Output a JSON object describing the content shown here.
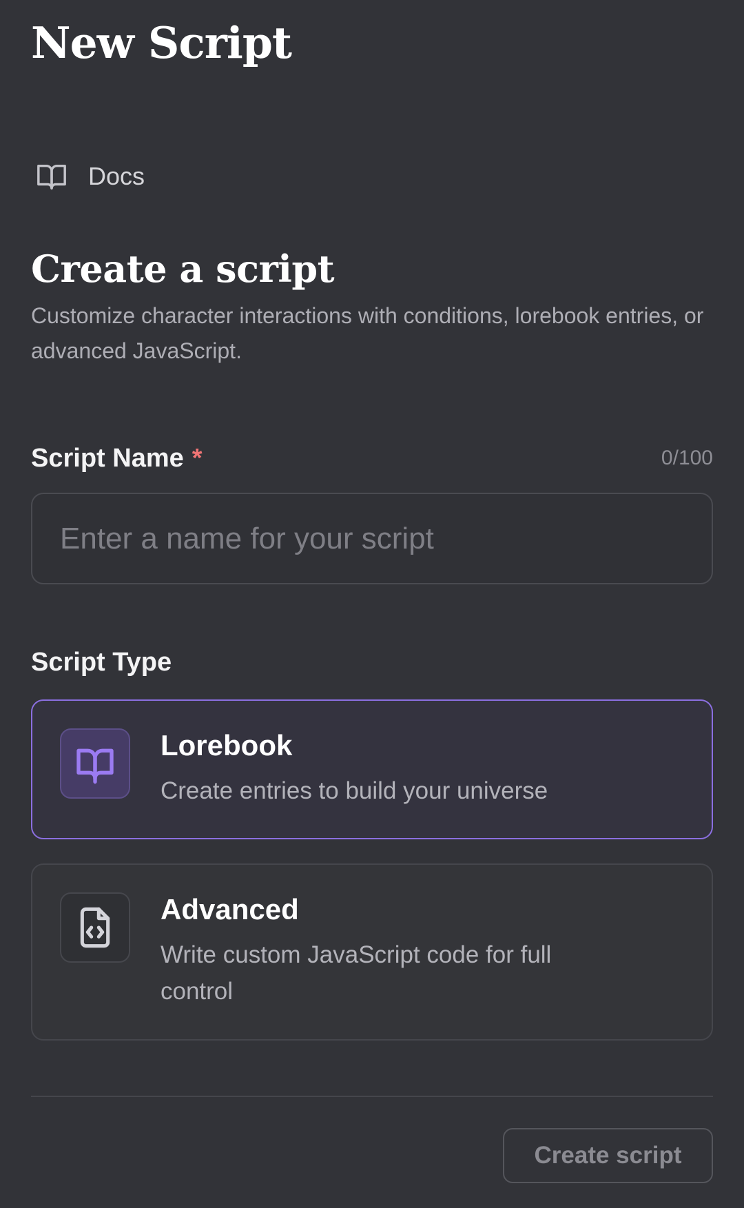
{
  "header": {
    "title": "New Script"
  },
  "docs": {
    "label": "Docs",
    "icon": "book-open-icon"
  },
  "intro": {
    "title": "Create a script",
    "description": "Customize character interactions with conditions, lorebook entries, or advanced JavaScript."
  },
  "name_field": {
    "label": "Script Name",
    "required_mark": "*",
    "counter": "0/100",
    "value": "",
    "placeholder": "Enter a name for your script"
  },
  "script_type": {
    "label": "Script Type",
    "selected": "Lorebook",
    "options": [
      {
        "title": "Lorebook",
        "description": "Create entries to build your universe",
        "icon": "book-open-icon"
      },
      {
        "title": "Advanced",
        "description": "Write custom JavaScript code for full control",
        "icon": "file-code-icon"
      }
    ]
  },
  "footer": {
    "create_label": "Create script"
  },
  "colors": {
    "background": "#323338",
    "accent": "#8b6fe0",
    "required": "#f07575"
  }
}
